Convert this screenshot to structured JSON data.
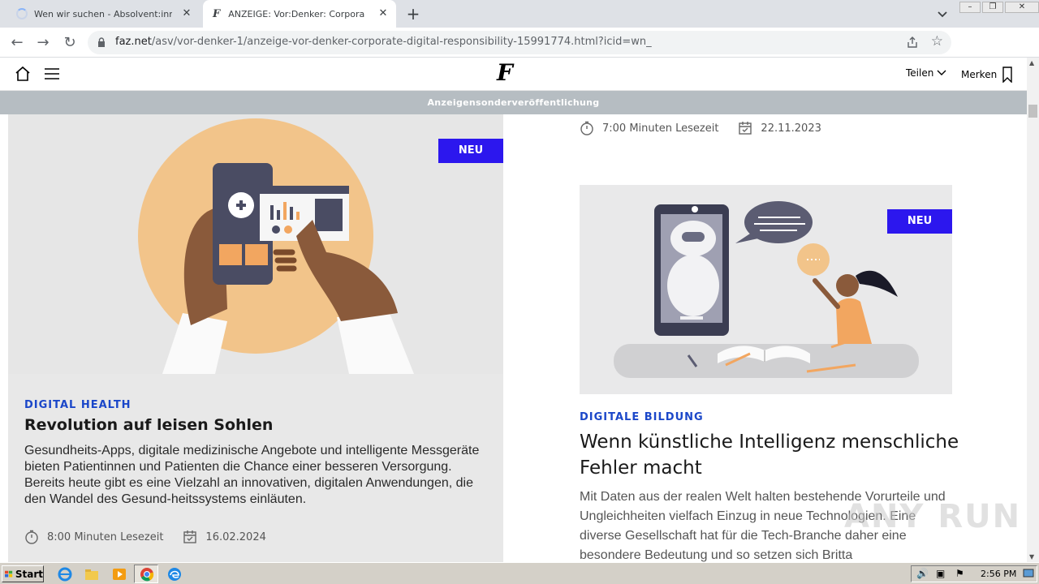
{
  "browser": {
    "tabs": [
      {
        "title": "Wen wir suchen - Absolvent:innen | "
      },
      {
        "title": "ANZEIGE: Vor:Denker: Corporate Di"
      }
    ],
    "url": {
      "host": "faz.net",
      "path": "/asv/vor-denker-1/anzeige-vor-denker-corporate-digital-responsibility-15991774.html?icid=wn_"
    }
  },
  "site": {
    "logo": "F",
    "share_label": "Teilen",
    "bookmark_label": "Merken",
    "ad_banner": "Anzeigensonderveröffentlichung"
  },
  "left_article": {
    "badge": "NEU",
    "kicker": "DIGITAL HEALTH",
    "headline": "Revolution auf leisen Sohlen",
    "teaser": "Gesundheits-Apps, digitale medizinische Angebote und intelligente Messgeräte bieten Patientinnen und Patienten die Chance einer besseren Versorgung. Bereits heute gibt es eine Vielzahl an innovativen, digitalen Anwendungen, die den Wandel des Gesund-heitssystems einläuten.",
    "reading_time": "8:00 Minuten Lesezeit",
    "date": "16.02.2024"
  },
  "right_top_meta": {
    "reading_time": "7:00 Minuten Lesezeit",
    "date": "22.11.2023"
  },
  "right_article": {
    "badge": "NEU",
    "kicker": "DIGITALE BILDUNG",
    "headline": "Wenn künstliche Intelligenz menschliche Fehler macht",
    "teaser": "Mit Daten aus der realen Welt halten bestehende Vorurteile und Ungleichheiten vielfach Einzug in neue Technologien. Eine diverse Gesellschaft hat für die Tech-Branche daher eine besondere Bedeutung und so setzen sich Britta"
  },
  "watermark": "ANY RUN",
  "taskbar": {
    "start_label": "Start",
    "clock": "2:56 PM"
  },
  "colors": {
    "accent_blue": "#2c17ee",
    "kicker_blue": "#1b47c9",
    "ad_bar": "#b6bdc2"
  }
}
